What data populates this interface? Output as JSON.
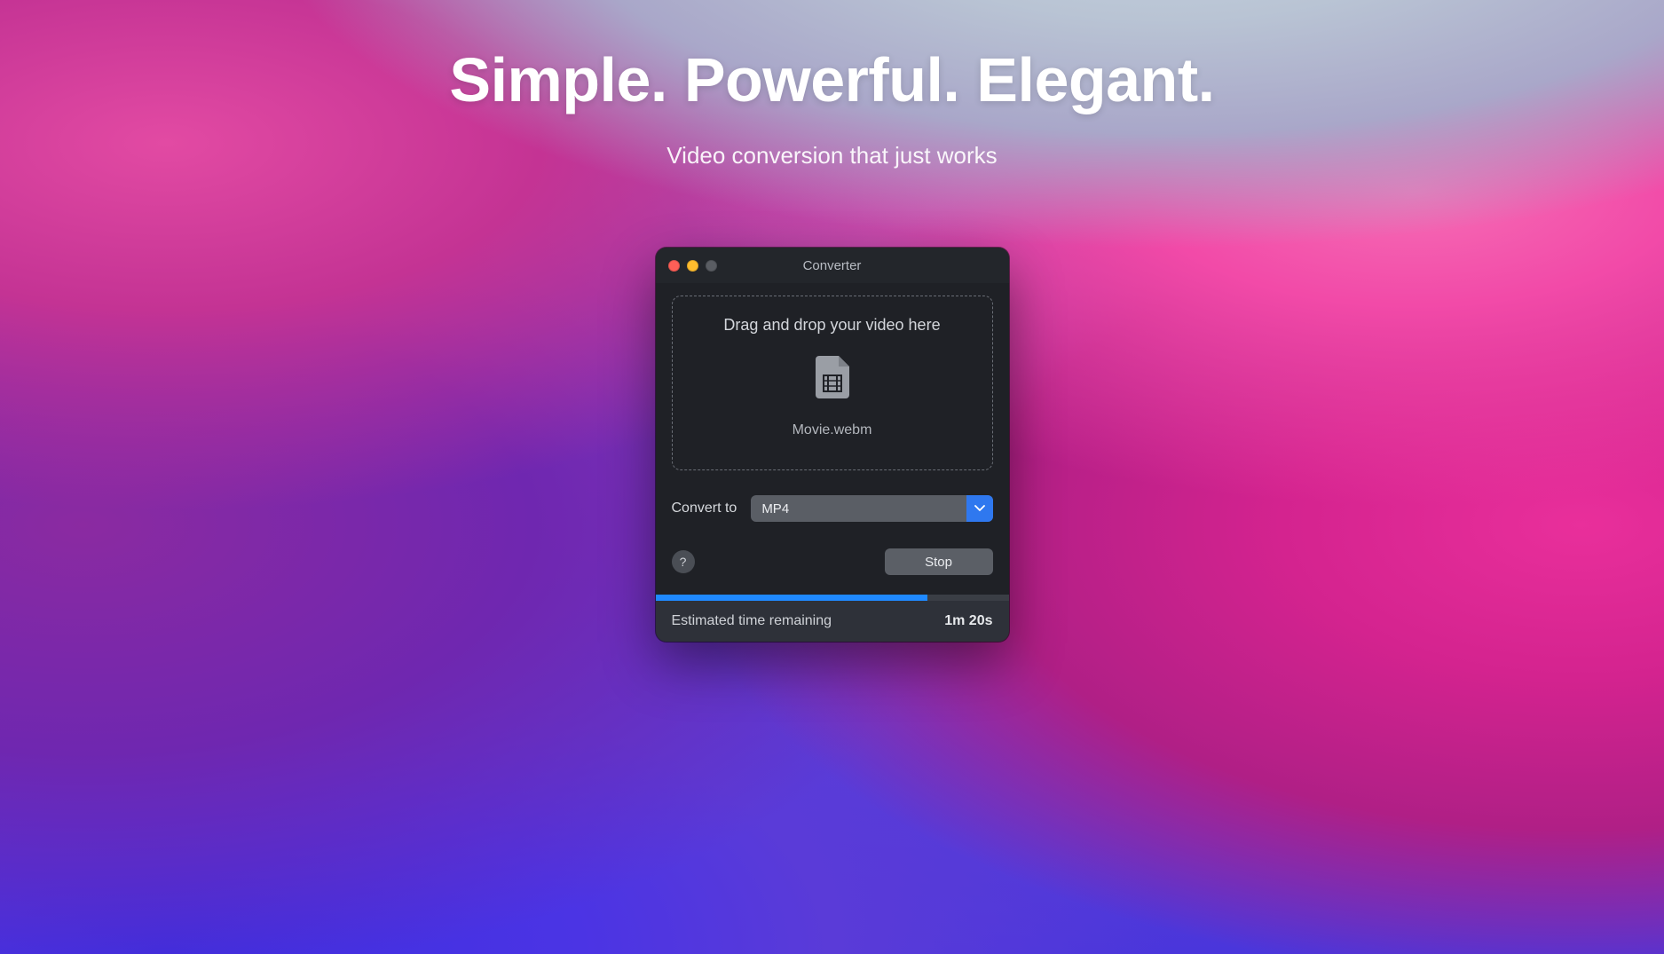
{
  "hero": {
    "title": "Simple. Powerful. Elegant.",
    "subtitle": "Video conversion that just works"
  },
  "window": {
    "title": "Converter",
    "dropzone": {
      "prompt": "Drag and drop your video here",
      "filename": "Movie.webm"
    },
    "convert": {
      "label": "Convert to",
      "selected": "MP4"
    },
    "help_label": "?",
    "stop_label": "Stop",
    "progress_percent": 77,
    "footer": {
      "label": "Estimated time remaining",
      "value": "1m 20s"
    }
  },
  "colors": {
    "accent": "#2f78ef",
    "progress": "#1f89ff",
    "window_bg": "#1f2126"
  }
}
